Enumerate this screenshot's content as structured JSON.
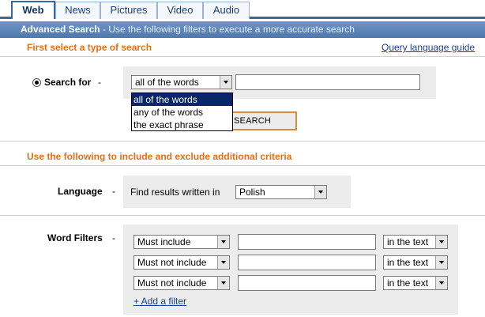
{
  "tabs": [
    {
      "label": "Web",
      "active": true
    },
    {
      "label": "News",
      "active": false
    },
    {
      "label": "Pictures",
      "active": false
    },
    {
      "label": "Video",
      "active": false
    },
    {
      "label": "Audio",
      "active": false
    }
  ],
  "header": {
    "title": "Advanced Search",
    "description": " - Use the following filters to execute a more accurate search"
  },
  "search_type": {
    "section_title": "First select a type of search",
    "query_guide_link": "Query language guide",
    "search_for_label": "Search for",
    "dash": "-",
    "selected_mode": "all of the words",
    "query_value": "",
    "options": [
      "all of the words",
      "any of the words",
      "the exact phrase"
    ],
    "search_button": "SEARCH"
  },
  "criteria": {
    "section_title": "Use the following to include and exclude additional criteria",
    "language_label": "Language",
    "dash": "-",
    "language_prompt": "Find results written in",
    "language_value": "Polish",
    "word_filters_label": "Word Filters",
    "filters": [
      {
        "mode": "Must include",
        "value": "",
        "location": "in the text"
      },
      {
        "mode": "Must not include",
        "value": "",
        "location": "in the text"
      },
      {
        "mode": "Must not include",
        "value": "",
        "location": "in the text"
      }
    ],
    "add_filter": "+ Add a filter"
  },
  "colors": {
    "accent_orange": "#e0701a",
    "header_blue": "#4e78ad",
    "link_blue": "#1c3f93",
    "panel_gray": "#ececec"
  }
}
